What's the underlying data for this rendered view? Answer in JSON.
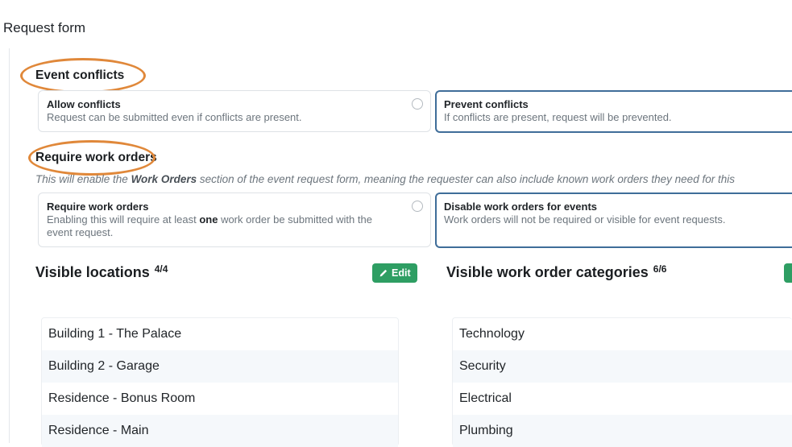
{
  "page_title": "Request form",
  "event_conflicts": {
    "title": "Event conflicts",
    "options": [
      {
        "title": "Allow conflicts",
        "desc": "Request can be submitted even if conflicts are present."
      },
      {
        "title": "Prevent conflicts",
        "desc": "If conflicts are present, request will be prevented."
      }
    ]
  },
  "work_orders": {
    "title": "Require work orders",
    "note_before": "This will enable the ",
    "note_bold": "Work Orders",
    "note_after": " section of the event request form, meaning the requester can also include known work orders they need for this",
    "options": [
      {
        "title": "Require work orders",
        "desc_before": "Enabling this will require at least ",
        "desc_bold": "one",
        "desc_after": " work order be submitted with the event request."
      },
      {
        "title": "Disable work orders for events",
        "desc": "Work orders will not be required or visible for event requests."
      }
    ]
  },
  "visible_locations": {
    "title": "Visible locations",
    "count": "4/4",
    "edit_label": "Edit",
    "items": [
      "Building 1 - The Palace",
      "Building 2 - Garage",
      "Residence - Bonus Room",
      "Residence - Main"
    ]
  },
  "visible_categories": {
    "title": "Visible work order categories",
    "count": "6/6",
    "items": [
      "Technology",
      "Security",
      "Electrical",
      "Plumbing"
    ]
  },
  "colors": {
    "highlight": "#e0883a",
    "selected_border": "#3f6d99",
    "edit_button": "#2e9e63"
  },
  "icons": {
    "edit": "pencil-icon",
    "radio": "radio-circle-icon"
  }
}
